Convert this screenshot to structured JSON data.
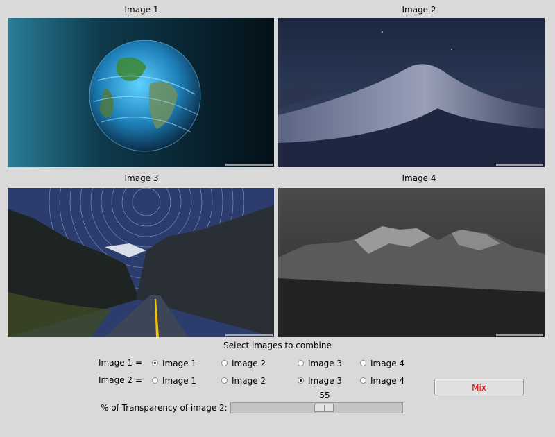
{
  "images": [
    {
      "title": "Image 1"
    },
    {
      "title": "Image 2"
    },
    {
      "title": "Image 3"
    },
    {
      "title": "Image 4"
    }
  ],
  "select_title": "Select images to combine",
  "rows": [
    {
      "label": "Image 1",
      "eq": "=",
      "options": [
        "Image 1",
        "Image 2",
        "Image 3",
        "Image 4"
      ],
      "selected": 0
    },
    {
      "label": "Image 2",
      "eq": "=",
      "options": [
        "Image 1",
        "Image 2",
        "Image 3",
        "Image 4"
      ],
      "selected": 2
    }
  ],
  "slider": {
    "label": "% of Transparency of image 2:",
    "value": "55",
    "min": 0,
    "max": 100
  },
  "mix_button": {
    "label": "Mix",
    "color": "#e00000"
  }
}
